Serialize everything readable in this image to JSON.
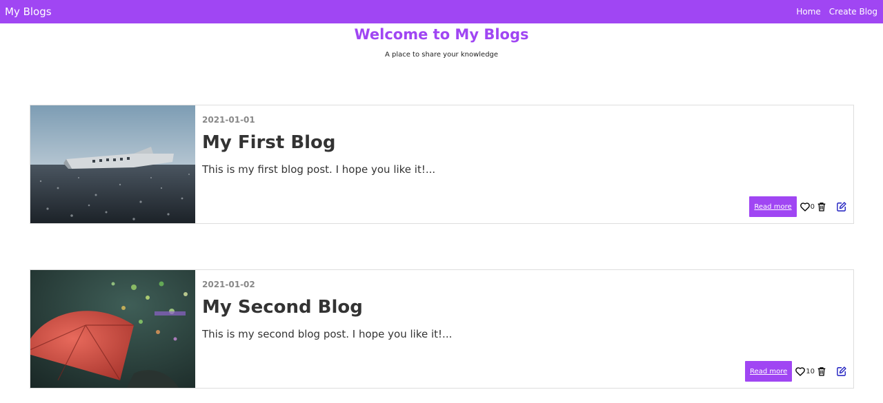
{
  "navbar": {
    "brand": "My Blogs",
    "links": [
      {
        "label": "Home"
      },
      {
        "label": "Create Blog"
      }
    ]
  },
  "hero": {
    "title": "Welcome to My Blogs",
    "subtitle": "A place to share your knowledge"
  },
  "colors": {
    "brand": "#a046f3",
    "edit_icon": "#1d1dbf"
  },
  "posts": [
    {
      "date": "2021-01-01",
      "title": "My First Blog",
      "excerpt": "This is my first blog post. I hope you like it!...",
      "read_more_label": "Read more",
      "likes": "0",
      "image": "plane-wreck-on-beach-photo"
    },
    {
      "date": "2021-01-02",
      "title": "My Second Blog",
      "excerpt": "This is my second blog post. I hope you like it!...",
      "read_more_label": "Read more",
      "likes": "10",
      "image": "red-umbrella-in-rain-photo"
    }
  ],
  "icons": {
    "like": "heart-outline-icon",
    "delete": "trash-icon",
    "edit": "pencil-square-icon"
  }
}
